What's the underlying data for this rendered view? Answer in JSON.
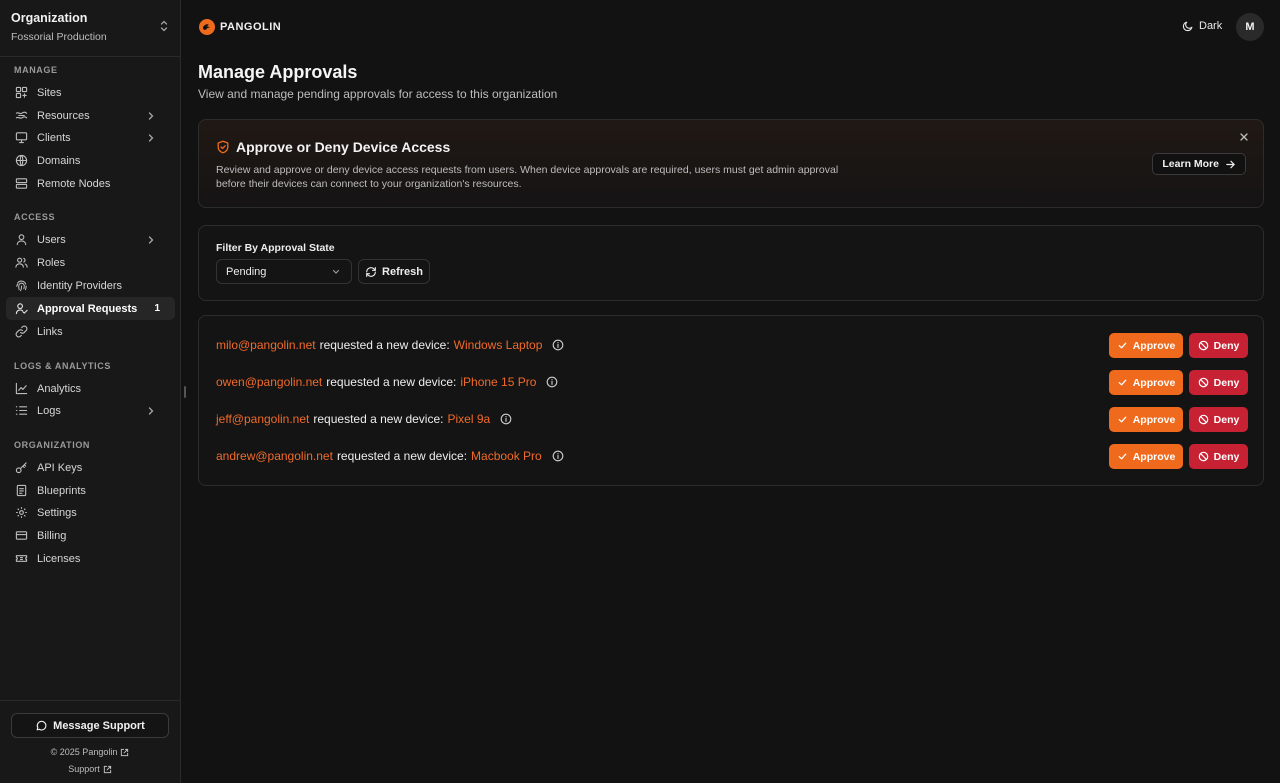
{
  "sidebar": {
    "org_label": "Organization",
    "org_name": "Fossorial Production",
    "sections": {
      "manage": "MANAGE",
      "access": "ACCESS",
      "logs": "LOGS & ANALYTICS",
      "organization": "ORGANIZATION"
    },
    "items": {
      "sites": "Sites",
      "resources": "Resources",
      "clients": "Clients",
      "domains": "Domains",
      "remote_nodes": "Remote Nodes",
      "users": "Users",
      "roles": "Roles",
      "identity_providers": "Identity Providers",
      "approval_requests": "Approval Requests",
      "approval_badge": "1",
      "links": "Links",
      "analytics": "Analytics",
      "logs": "Logs",
      "api_keys": "API Keys",
      "blueprints": "Blueprints",
      "settings": "Settings",
      "billing": "Billing",
      "licenses": "Licenses"
    },
    "footer": {
      "support_button": "Message Support",
      "copyright": "© 2025 Pangolin",
      "support_link": "Support"
    }
  },
  "header": {
    "brand": "PANGOLIN",
    "theme_label": "Dark",
    "avatar_initial": "M"
  },
  "page": {
    "title": "Manage Approvals",
    "subtitle": "View and manage pending approvals for access to this organization"
  },
  "banner": {
    "title": "Approve or Deny Device Access",
    "text": "Review and approve or deny device access requests from users. When device approvals are required, users must get admin approval before their devices can connect to your organization's resources.",
    "learn_more": "Learn More"
  },
  "filter": {
    "label": "Filter By Approval State",
    "selected": "Pending",
    "refresh": "Refresh"
  },
  "requests": {
    "mid_text": "requested a new device:",
    "approve_label": "Approve",
    "deny_label": "Deny",
    "rows": [
      {
        "email": "milo@pangolin.net",
        "device": "Windows Laptop"
      },
      {
        "email": "owen@pangolin.net",
        "device": "iPhone 15 Pro"
      },
      {
        "email": "jeff@pangolin.net",
        "device": "Pixel 9a"
      },
      {
        "email": "andrew@pangolin.net",
        "device": "Macbook Pro"
      }
    ]
  },
  "colors": {
    "accent": "#f06a1e",
    "deny": "#c62234",
    "background": "#121212"
  }
}
